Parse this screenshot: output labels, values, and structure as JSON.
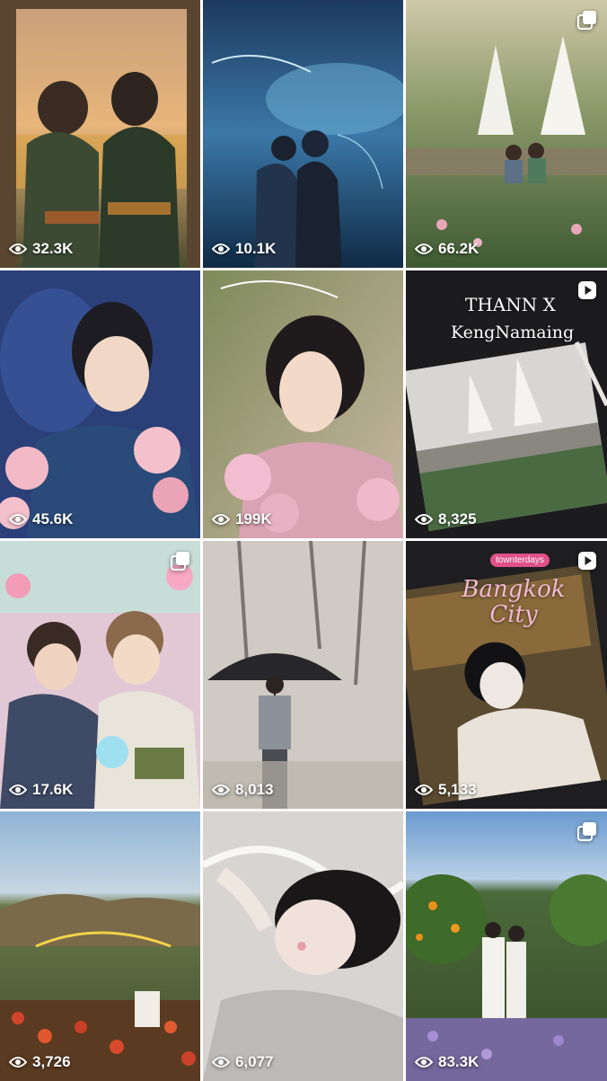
{
  "posts": [
    {
      "views": "32.3K",
      "type": "image"
    },
    {
      "views": "10.1K",
      "type": "image"
    },
    {
      "views": "66.2K",
      "type": "carousel"
    },
    {
      "views": "45.6K",
      "type": "image"
    },
    {
      "views": "199K",
      "type": "image"
    },
    {
      "views": "8,325",
      "type": "reel",
      "caption_line1": "THANN X",
      "caption_line2": "KengNamaing"
    },
    {
      "views": "17.6K",
      "type": "carousel"
    },
    {
      "views": "8,013",
      "type": "image"
    },
    {
      "views": "5,133",
      "type": "reel",
      "caption": "Bangkok City",
      "tag": "townterdays"
    },
    {
      "views": "3,726",
      "type": "image"
    },
    {
      "views": "6,077",
      "type": "image"
    },
    {
      "views": "83.3K",
      "type": "carousel"
    }
  ],
  "icons": {
    "views": "eye-icon",
    "carousel": "multiple-posts-icon",
    "reel": "reel-play-icon"
  },
  "colors": {
    "overlay_text": "#ffffff",
    "grid_gap": "#ffffff"
  }
}
